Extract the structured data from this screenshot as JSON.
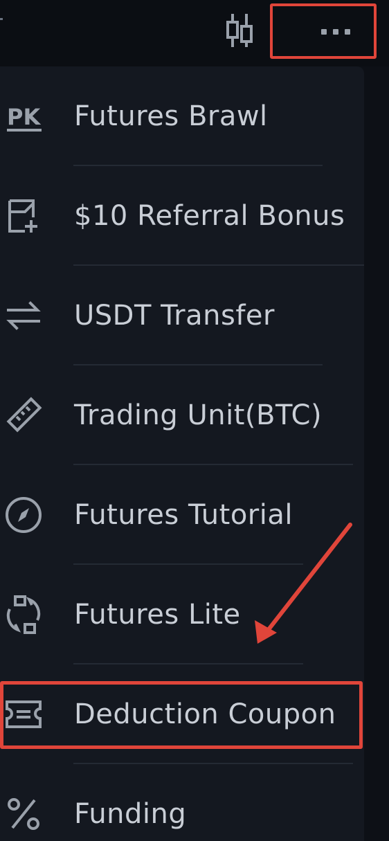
{
  "header": {
    "chart_icon": "candlestick-chart-icon",
    "more_icon": "more-dots-icon"
  },
  "menu": {
    "items": [
      {
        "label": "Futures Brawl",
        "icon": "pk-icon"
      },
      {
        "label": "$10 Referral Bonus",
        "icon": "referral-bonus-icon"
      },
      {
        "label": "USDT Transfer",
        "icon": "transfer-arrows-icon"
      },
      {
        "label": "Trading Unit(BTC)",
        "icon": "ruler-icon"
      },
      {
        "label": "Futures Tutorial",
        "icon": "compass-icon"
      },
      {
        "label": "Futures Lite",
        "icon": "rotate-switch-icon"
      },
      {
        "label": "Deduction Coupon",
        "icon": "coupon-ticket-icon"
      },
      {
        "label": "Funding",
        "icon": "percent-icon"
      }
    ]
  },
  "annotations": {
    "highlight_color": "#e0453a",
    "highlighted_items": [
      "more-button",
      "menu-item-deduction-coupon"
    ]
  },
  "colors": {
    "background": "#0d1016",
    "menu_background": "#141820",
    "text": "#c9ced6",
    "icon": "#9aa1ab",
    "divider": "#242a34"
  }
}
